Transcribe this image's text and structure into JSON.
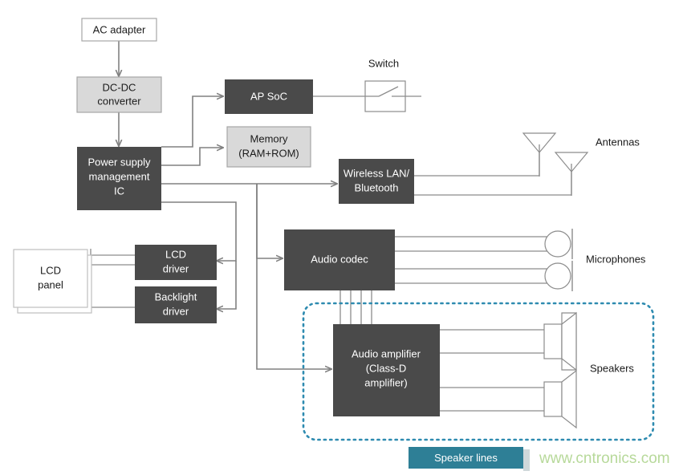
{
  "diagram": {
    "title_present": false,
    "colors": {
      "dark_block": "#4a4a4a",
      "light_block": "#d9d9d9",
      "white_block": "#ffffff",
      "wire": "#808080",
      "outline": "#8c8c8c",
      "accent_teal": "#2e7f96",
      "dotted_boundary": "#2e8bb0",
      "watermark_green": "#b7d99a",
      "text_dark": "#1a1a1a",
      "text_light": "#ffffff"
    },
    "blocks": [
      {
        "id": "ac_adapter",
        "label": "AC adapter",
        "lines": [
          "AC adapter"
        ],
        "style": "white"
      },
      {
        "id": "dcdc",
        "label": "DC-DC converter",
        "lines": [
          "DC-DC",
          "converter"
        ],
        "style": "light"
      },
      {
        "id": "pmic",
        "label": "Power supply management IC",
        "lines": [
          "Power supply",
          "management",
          "IC"
        ],
        "style": "dark"
      },
      {
        "id": "ap_soc",
        "label": "AP SoC",
        "lines": [
          "AP SoC"
        ],
        "style": "dark"
      },
      {
        "id": "memory",
        "label": "Memory (RAM+ROM)",
        "lines": [
          "Memory",
          "(RAM+ROM)"
        ],
        "style": "light"
      },
      {
        "id": "wlan_bt",
        "label": "Wireless LAN/Bluetooth",
        "lines": [
          "Wireless LAN/",
          "Bluetooth"
        ],
        "style": "dark"
      },
      {
        "id": "audio_codec",
        "label": "Audio codec",
        "lines": [
          "Audio codec"
        ],
        "style": "dark"
      },
      {
        "id": "audio_amp",
        "label": "Audio amplifier (Class-D amplifier)",
        "lines": [
          "Audio amplifier",
          "(Class-D",
          "amplifier)"
        ],
        "style": "dark"
      },
      {
        "id": "lcd_panel",
        "label": "LCD panel",
        "lines": [
          "LCD",
          "panel"
        ],
        "style": "white"
      },
      {
        "id": "lcd_driver",
        "label": "LCD driver",
        "lines": [
          "LCD",
          "driver"
        ],
        "style": "dark"
      },
      {
        "id": "backlight_driver",
        "label": "Backlight driver",
        "lines": [
          "Backlight",
          "driver"
        ],
        "style": "dark"
      }
    ],
    "annotations": [
      {
        "id": "switch_label",
        "text": "Switch"
      },
      {
        "id": "antennas_label",
        "text": "Antennas"
      },
      {
        "id": "microphones_label",
        "text": "Microphones"
      },
      {
        "id": "speakers_label",
        "text": "Speakers"
      }
    ],
    "legend": {
      "label": "Speaker lines"
    },
    "watermark": {
      "text": "www.cntronics.com"
    },
    "peripherals": {
      "switch_count": 1,
      "antenna_count": 2,
      "microphone_count": 2,
      "speaker_count": 2,
      "codec_to_amp_lines": 4
    }
  }
}
